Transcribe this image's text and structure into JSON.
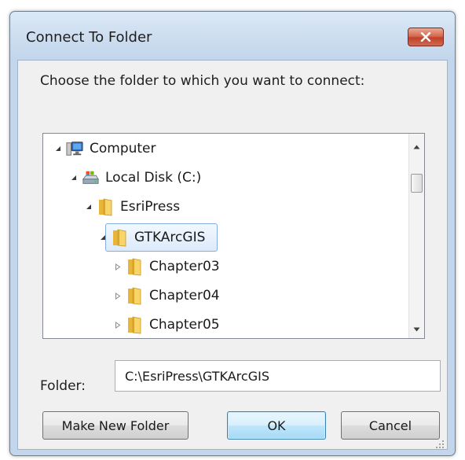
{
  "window": {
    "title": "Connect To Folder",
    "close_icon": "close-x-icon"
  },
  "dialog": {
    "prompt": "Choose the folder to which you want to connect:"
  },
  "tree": {
    "nodes": [
      {
        "label": "Computer",
        "icon": "computer-icon",
        "expander": "expanded"
      },
      {
        "label": "Local Disk (C:)",
        "icon": "local-disk-icon",
        "expander": "expanded"
      },
      {
        "label": "EsriPress",
        "icon": "folder-icon",
        "expander": "expanded"
      },
      {
        "label": "GTKArcGIS",
        "icon": "folder-icon",
        "expander": "expanded",
        "selected": true
      },
      {
        "label": "Chapter03",
        "icon": "folder-icon",
        "expander": "collapsed"
      },
      {
        "label": "Chapter04",
        "icon": "folder-icon",
        "expander": "collapsed"
      },
      {
        "label": "Chapter05",
        "icon": "folder-icon",
        "expander": "collapsed"
      }
    ]
  },
  "folder": {
    "label": "Folder:",
    "value": "C:\\EsriPress\\GTKArcGIS"
  },
  "buttons": {
    "make_new_folder": "Make New Folder",
    "ok": "OK",
    "cancel": "Cancel"
  },
  "colors": {
    "selection_border": "#84acdd",
    "close_button": "#c0412a",
    "default_button_border": "#3c7fb1",
    "folder_yellow": "#f2c94c"
  }
}
